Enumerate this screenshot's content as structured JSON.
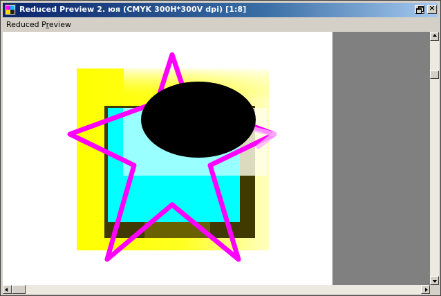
{
  "window": {
    "title": "Reduced Preview 2. юя (CMYK 300H*300V dpi)  [1:8]"
  },
  "menu": {
    "items": [
      {
        "label_pre": "Reduced P",
        "label_ul": "r",
        "label_post": "eview"
      }
    ]
  },
  "preview": {
    "shape_colors": {
      "yellow": "#ffff00",
      "cyan": "#00ffff",
      "magenta_outline": "#ff00ff",
      "dark_olive": "#403a00",
      "black_ellipse": "#000000",
      "pale_cyan": "#b8f4ff"
    }
  },
  "icons": {
    "app": "app-icon",
    "restore": "restore-icon",
    "close": "close-icon"
  }
}
